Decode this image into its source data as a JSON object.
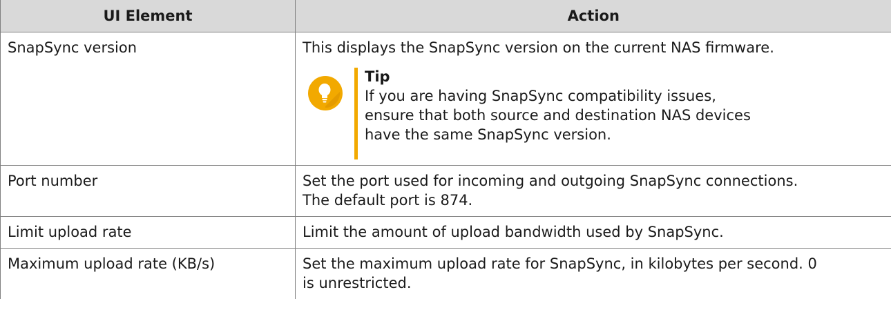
{
  "table": {
    "headers": [
      "UI Element",
      "Action"
    ],
    "rows": [
      {
        "element": "SnapSync version",
        "action": "This displays the SnapSync version on the current NAS firmware.",
        "tip": {
          "title": "Tip",
          "icon": "lightbulb-icon",
          "accent_color": "#f2a900",
          "lines": [
            "If you are having SnapSync compatibility issues,",
            "ensure that both source and destination NAS devices",
            "have the same SnapSync version."
          ]
        }
      },
      {
        "element": "Port number",
        "action_lines": [
          "Set the port used for incoming and outgoing SnapSync connections.",
          "The default port is 874."
        ]
      },
      {
        "element": "Limit upload rate",
        "action": "Limit the amount of upload bandwidth used by SnapSync."
      },
      {
        "element": "Maximum upload rate (KB/s)",
        "action_lines": [
          "Set the maximum upload rate for SnapSync, in kilobytes per second. 0",
          "is unrestricted."
        ]
      }
    ]
  }
}
